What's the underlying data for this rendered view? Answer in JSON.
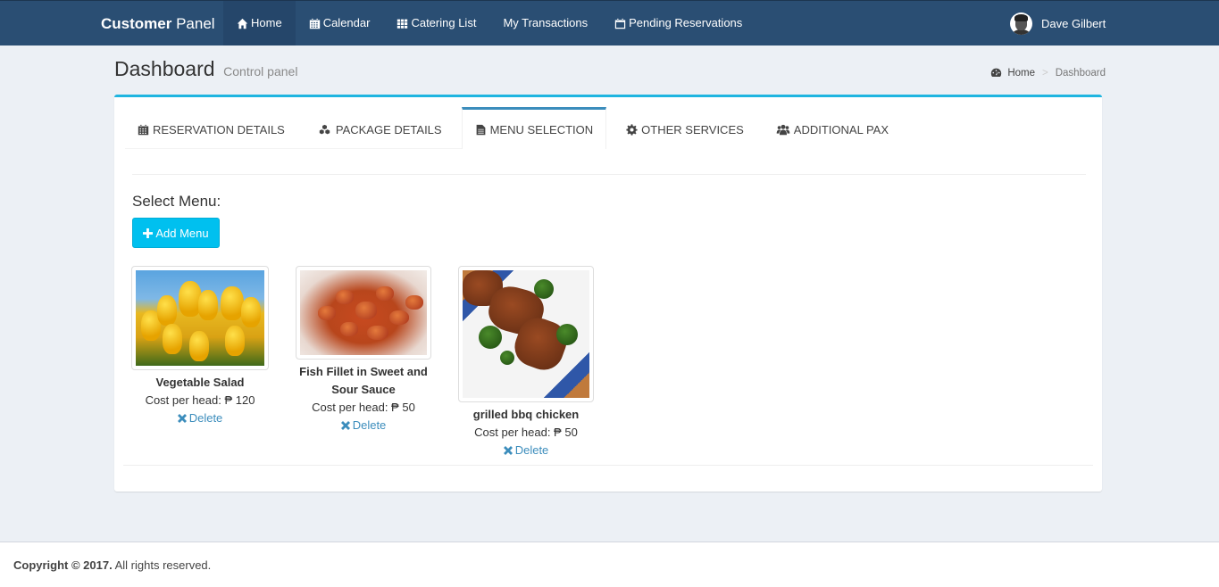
{
  "navbar": {
    "brand_bold": "Customer",
    "brand_light": " Panel",
    "items": [
      {
        "label": "Home",
        "icon": "home-icon",
        "active": true
      },
      {
        "label": "Calendar",
        "icon": "calendar-icon",
        "active": false
      },
      {
        "label": "Catering List",
        "icon": "th-list-icon",
        "active": false
      },
      {
        "label": "My Transactions",
        "icon": "",
        "active": false
      },
      {
        "label": "Pending Reservations",
        "icon": "calendar-empty-icon",
        "active": false
      }
    ],
    "user_name": "Dave Gilbert"
  },
  "header": {
    "title": "Dashboard",
    "subtitle": "Control panel",
    "breadcrumb": {
      "home": "Home",
      "separator": ">",
      "current": "Dashboard"
    }
  },
  "tabs": [
    {
      "label": "Reservation Details",
      "icon": "calendar-icon",
      "active": false
    },
    {
      "label": "Package Details",
      "icon": "cubes-icon",
      "active": false
    },
    {
      "label": "Menu Selection",
      "icon": "file-text-icon",
      "active": true
    },
    {
      "label": "Other Services",
      "icon": "gear-icon",
      "active": false
    },
    {
      "label": "Additional Pax",
      "icon": "users-icon",
      "active": false
    }
  ],
  "menu": {
    "select_label": "Select Menu:",
    "add_button": "Add Menu",
    "items": [
      {
        "name": "Vegetable Salad",
        "cost": "Cost per head: ₱ 120",
        "delete": "Delete",
        "image": "yellow tulips"
      },
      {
        "name": "Fish Fillet in Sweet and Sour Sauce",
        "cost": "Cost per head: ₱ 50",
        "delete": "Delete",
        "image": "sweet and sour fish"
      },
      {
        "name": "grilled bbq chicken",
        "cost": "Cost per head: ₱ 50",
        "delete": "Delete",
        "image": "grilled chicken with broccoli"
      }
    ]
  },
  "footer": {
    "copyright_bold": "Copyright © 2017.",
    "copyright_rest": " All rights reserved."
  },
  "colors": {
    "navbar": "#2a4e73",
    "accent": "#00c0ef",
    "box_top_border": "#1fb5e0",
    "active_tab_border": "#3c8dbc",
    "link": "#3c8dbc",
    "background": "#ecf0f5"
  }
}
